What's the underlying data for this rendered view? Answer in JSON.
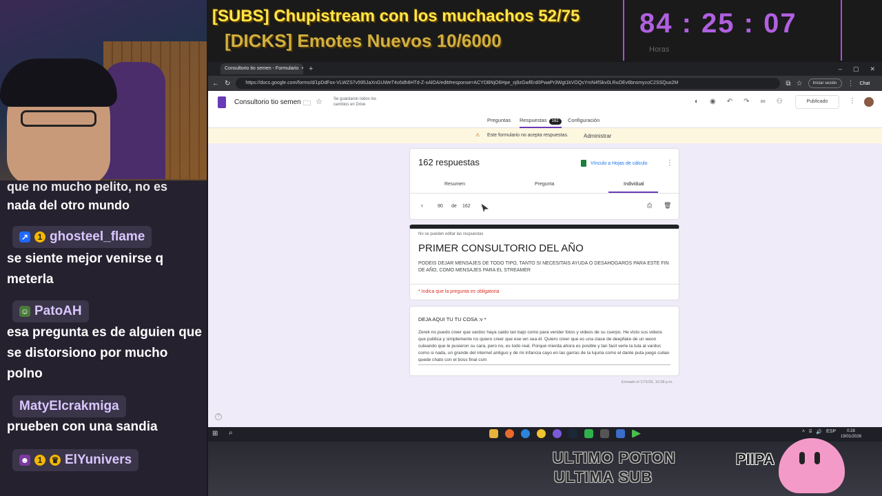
{
  "overlay": {
    "marquee1": "[SUBS] Chupistream con los muchachos 52/75",
    "marquee2": "[DICKS] Emotes Nuevos 10/6000",
    "timer": {
      "hours": "84",
      "minutes": "25",
      "seconds": "07",
      "label": "Horas"
    },
    "promo_line1": "ULTIMO POTON",
    "promo_line2": "ULTIMA SUB",
    "brand": "PIIPA"
  },
  "chat": {
    "fragment_top": "que no mucho pelito, no es",
    "fragment_line": "nada del otro mundo",
    "messages": [
      {
        "user": "ghosteel_flame",
        "badge": "1",
        "text": "se siente mejor venirse q meterla"
      },
      {
        "user": "PatoAH",
        "badge": "",
        "text": "esa pregunta es de alguien que se distorsiono por mucho polno"
      },
      {
        "user": "MatyElcrakmiga",
        "badge": "",
        "text": "prueben con una sandia"
      },
      {
        "user": "ElYunivers",
        "badge": "1",
        "text": ""
      }
    ]
  },
  "browser": {
    "tab_title": "Consultorio tio semen - Formulario",
    "tab_close": "×",
    "new_tab": "+",
    "url": "https://docs.google.com/forms/d/1pDdFox-VLWZS7v595JaXnGUWeT4o5dh8HTd-Z-xAlOA/edit#response=ACYDBNjO6Hpe_oj9zGwfErd0PwaPr3Wgt1kVOQsYmN4fSkv0LRuOEv6bnsmycoC2SSQuo2M",
    "signin_label": "Iniciar sesión",
    "chat_label": "Chat"
  },
  "form": {
    "title": "Consultorio tio semen",
    "saved_note": "Se guardaron todos los cambios en Drive",
    "publish_label": "Publicado",
    "tabs": {
      "preguntas": "Preguntas",
      "respuestas": "Respuestas",
      "respuestas_count": "162",
      "configuracion": "Configuración"
    },
    "banner_text": "Este formulario no acepta respuestas.",
    "banner_action": "Administrar",
    "responses_title": "162 respuestas",
    "sheets_link": "Vínculo a Hojas de cálculo",
    "subtabs": {
      "resumen": "Resumen",
      "pregunta": "Pregunta",
      "individual": "Individual"
    },
    "pager": {
      "current": "90",
      "of": "de",
      "total": "162"
    },
    "readonly_note": "No se pueden editar las respuestas",
    "main_title": "PRIMER CONSULTORIO DEL AÑO",
    "description": "PODEIS DEJAR MENSAJES DE TODO TIPO, TANTO SI NECESITAIS AYUDA O DESAHOGAROS PARA ESTE FIN DE AÑO, COMO MENSAJES PARA EL STREAMER",
    "required_note": "* Indica que la pregunta es obligatoria",
    "question": "DEJA AQUI TU TU COSA :v *",
    "answer": "Zerek no puedo creer que vardoc haya caido tan bajo como para vender fotos y videos de su cuerpo. He visto sus videos que publica y simplemente no quiero creer que ese wn sea él. Quiero creer que es una clase de deepfake de un weon culeando que le pusieron su cara, pero no, es todo real. Porqué mierda ahora es posible y tan facil verle la tula al vardoc como si nada, un grande del internet antiguo y de mi infancia cayo en las garras de la lujuria como el dante puta juego culiao quede chato con el boss final csm",
    "sent_info": "Enviado el 17/1/26, 10:38 p.m."
  },
  "taskbar": {
    "lang": "ESP",
    "time": "0:28",
    "date": "19/01/2026"
  },
  "colors": {
    "accent": "#673ab7",
    "timer": "#b060e0",
    "marquee": "#ffe84a",
    "chat_bg": "#25212f"
  }
}
